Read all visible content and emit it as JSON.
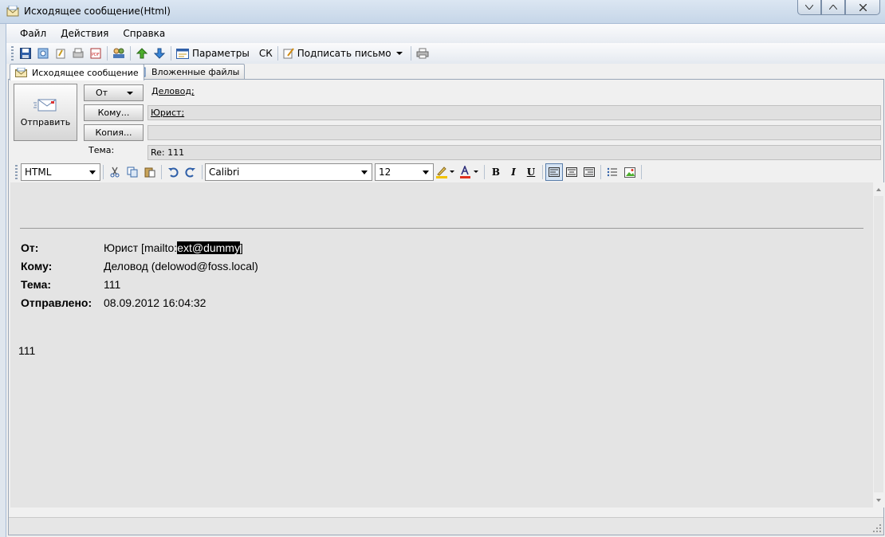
{
  "window": {
    "title": "Исходящее сообщение(Html)"
  },
  "menu": [
    "Файл",
    "Действия",
    "Справка"
  ],
  "toolbar": {
    "params_label": "Параметры",
    "ck_label": "СК",
    "sign_label": "Подписать письмо"
  },
  "tabs": [
    {
      "label": "Исходящее сообщение",
      "active": true
    },
    {
      "label": "Вложенные файлы",
      "active": false
    }
  ],
  "compose": {
    "send_label": "Отправить",
    "from_label": "От",
    "to_button": "Кому...",
    "cc_button": "Копия...",
    "subject_label": "Тема:",
    "from_value": "Деловод;",
    "to_value": "Юрист;",
    "cc_value": "",
    "subject_value": "Re: 111"
  },
  "format": {
    "mode": "HTML",
    "font": "Calibri",
    "size": "12"
  },
  "body": {
    "from_label": "От:",
    "from_prefix": "Юрист [mailto:",
    "from_highlight": "ext@dummy",
    "from_suffix": "]",
    "to_label": "Кому:",
    "to_value": "Деловод (delowod@foss.local)",
    "subject_label": "Тема:",
    "subject_value": "111",
    "sent_label": "Отправлено:",
    "sent_value": "08.09.2012 16:04:32",
    "text": "111"
  },
  "colors": {
    "highlight": "#f2c200",
    "font_color": "#e0301e",
    "accent": "#3a78c2"
  }
}
